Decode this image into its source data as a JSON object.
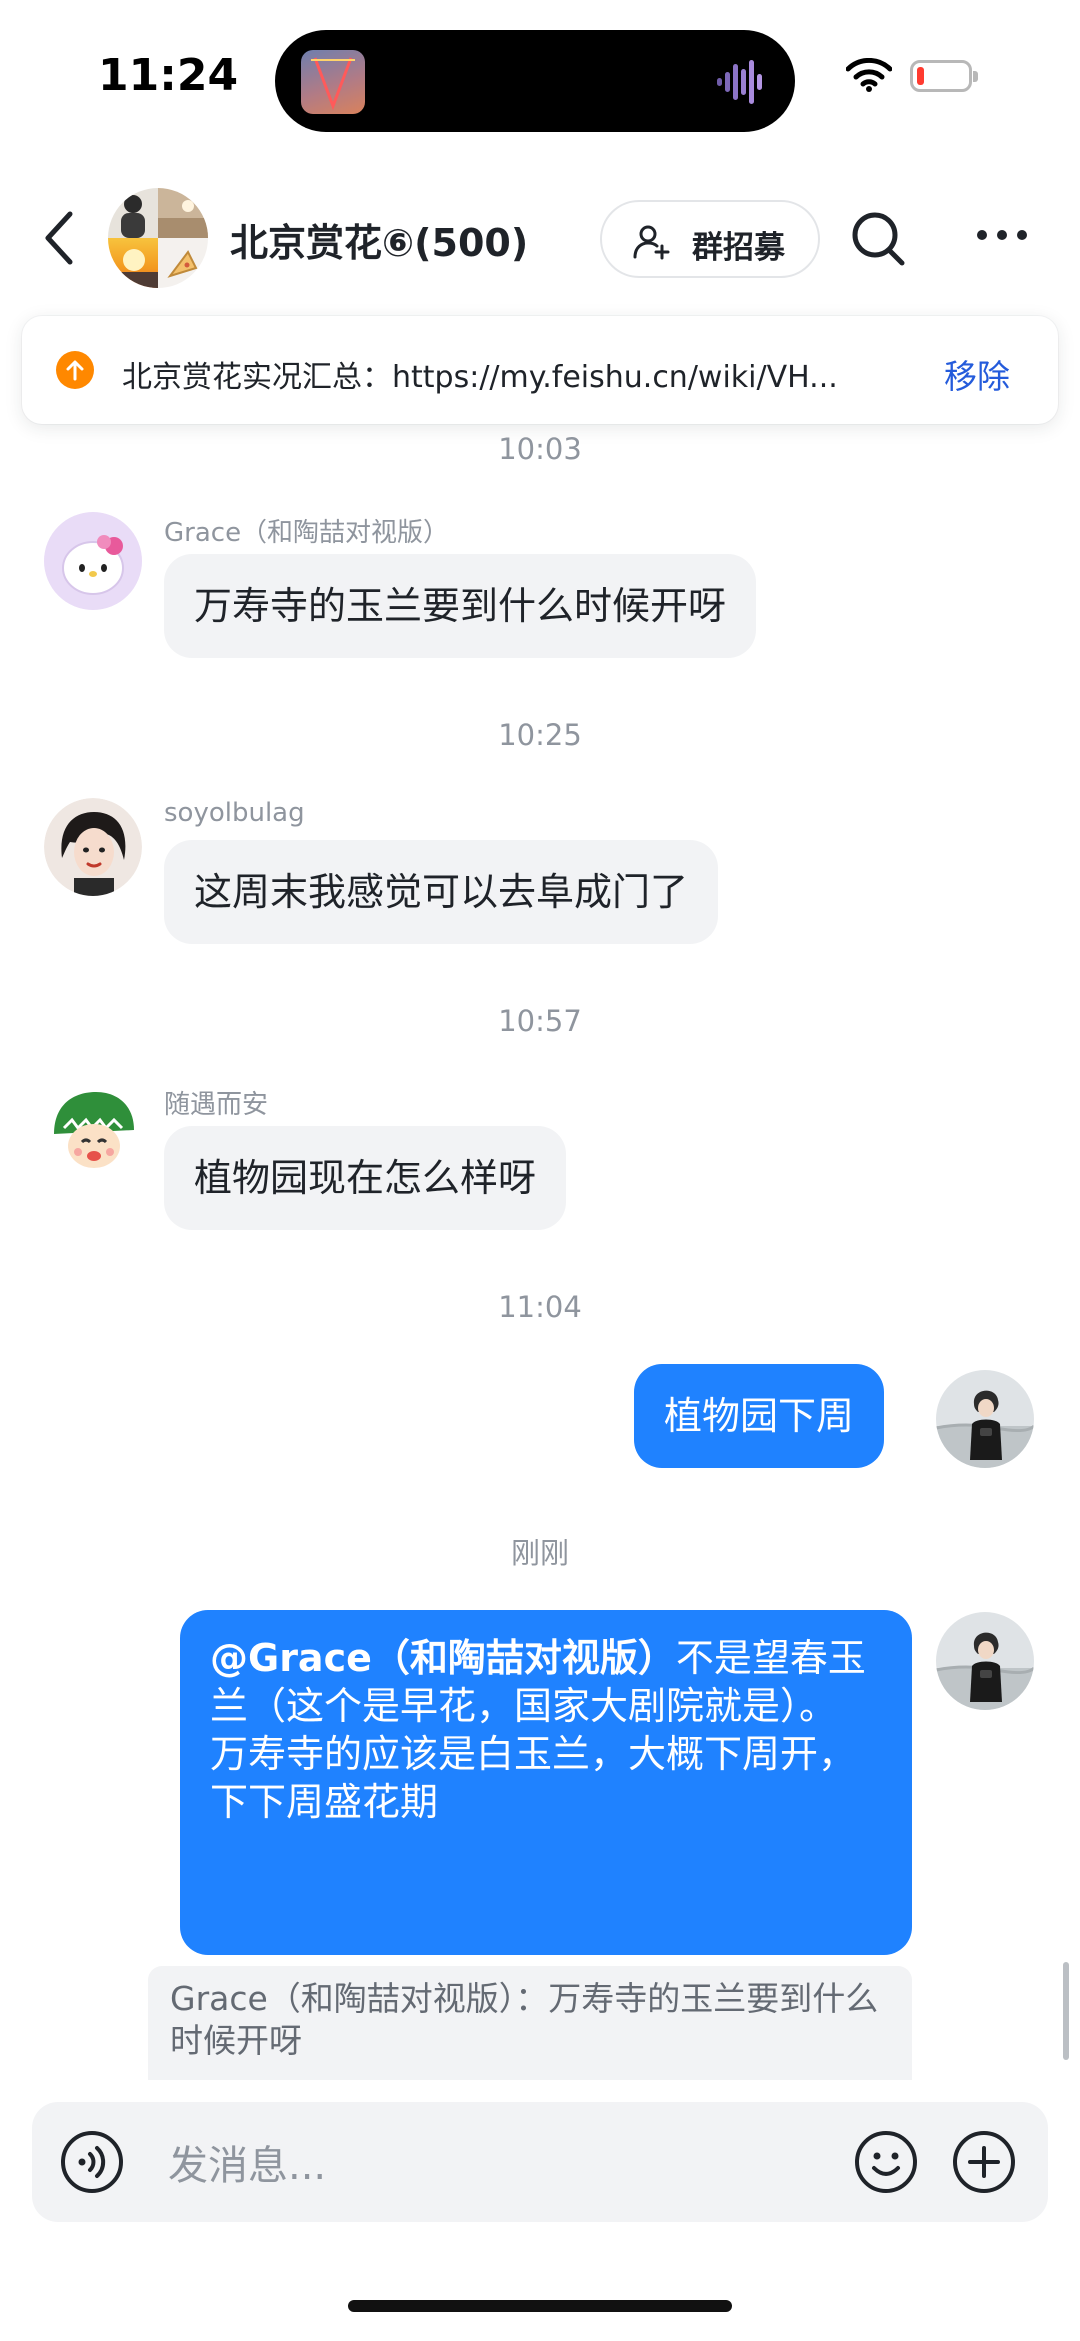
{
  "status_bar": {
    "time": "11:24",
    "battery_level": 0.1,
    "icons": [
      "island-artwork-icon",
      "audio-wave-icon",
      "wifi-icon",
      "battery-low-icon"
    ]
  },
  "header": {
    "back_icon": "chevron-left-icon",
    "title": "北京赏花⑥(500)",
    "recruit_label": "群招募",
    "recruit_icon": "add-user-icon",
    "search_icon": "search-icon",
    "more_icon": "more-icon"
  },
  "pinned": {
    "icon": "upload-arrow-icon",
    "text": "北京赏花实况汇总：https://my.feishu.cn/wiki/VH...",
    "remove_label": "移除"
  },
  "messages": [
    {
      "time": "10:03",
      "sender": "Grace（和陶喆对视版）",
      "text": "万寿寺的玉兰要到什么时候开呀"
    },
    {
      "time": "10:25",
      "sender": "soyolbulag",
      "text": "这周末我感觉可以去阜成门了"
    },
    {
      "time": "10:57",
      "sender": "随遇而安",
      "text": "植物园现在怎么样呀"
    },
    {
      "time": "11:04",
      "text": "植物园下周"
    },
    {
      "time": "刚刚",
      "mention": "@Grace（和陶喆对视版）",
      "line1_rest": "不是望春玉兰（这个是早花，国家大剧院就是）。",
      "line2": "万寿寺的应该是白玉兰，大概下周开，下下周盛花期",
      "quote": "Grace（和陶喆对视版）：万寿寺的玉兰要到什么时候开呀"
    }
  ],
  "composer": {
    "placeholder": "发消息...",
    "voice_icon": "voice-icon",
    "emoji_icon": "emoji-icon",
    "plus_icon": "plus-icon"
  },
  "colors": {
    "accent": "#1F82FF",
    "incoming_bubble": "#F2F3F5",
    "link_blue": "#245BDB",
    "pin_orange": "#FF8800",
    "muted_text": "#8F959E"
  }
}
